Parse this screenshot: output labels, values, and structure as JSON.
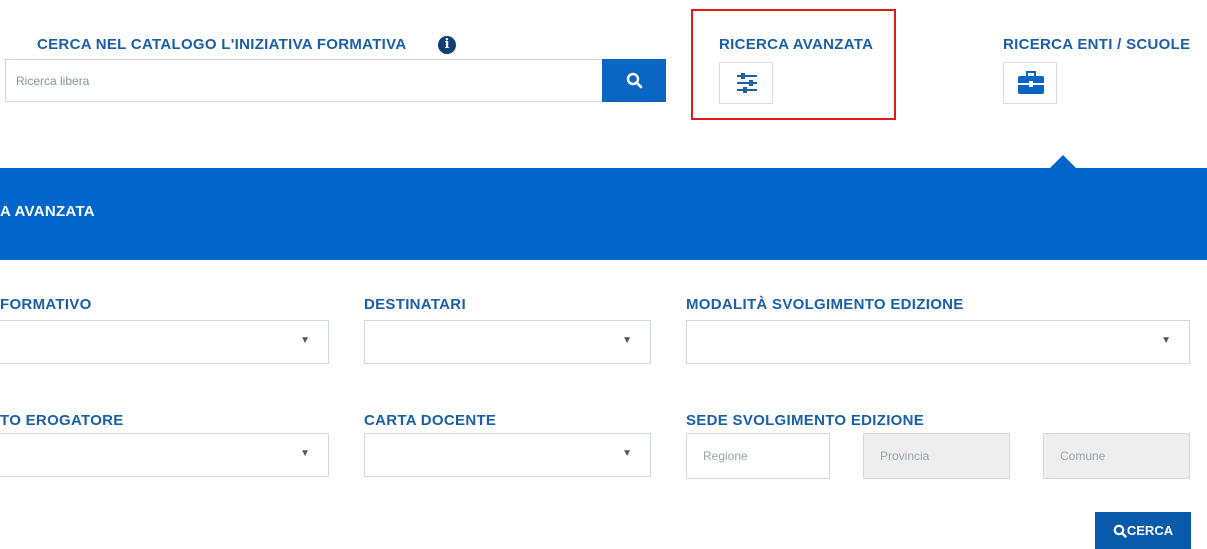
{
  "header": {
    "catalog_title": "CERCA NEL CATALOGO L'INIZIATIVA FORMATIVA",
    "info_symbol": "i",
    "search_placeholder": "Ricerca libera",
    "advanced_label": "RICERCA AVANZATA",
    "entities_label": "RICERCA ENTI / SCUOLE"
  },
  "panel": {
    "title_partial": "A AVANZATA"
  },
  "filters": {
    "row1": [
      {
        "label": "FORMATIVO",
        "value": ""
      },
      {
        "label": "DESTINATARI",
        "value": ""
      },
      {
        "label": "MODALITÀ SVOLGIMENTO EDIZIONE",
        "value": ""
      }
    ],
    "row2": [
      {
        "label": "TO EROGATORE",
        "value": ""
      },
      {
        "label": "CARTA DOCENTE",
        "value": ""
      },
      {
        "label": "SEDE SVOLGIMENTO EDIZIONE",
        "value": ""
      }
    ],
    "sede": {
      "regione": "Regione",
      "provincia": "Provincia",
      "comune": "Comune"
    }
  },
  "actions": {
    "search_button": "CERCA"
  },
  "colors": {
    "primary": "#0066cc",
    "label_blue": "#1a5fa8",
    "highlight_frame": "#e21a1a",
    "button_blue": "#0a5aab"
  },
  "icons": {
    "info": "info-icon",
    "search": "search-icon",
    "advanced": "sliders-icon",
    "entities": "briefcase-icon",
    "dropdown": "chevron-down-icon"
  }
}
